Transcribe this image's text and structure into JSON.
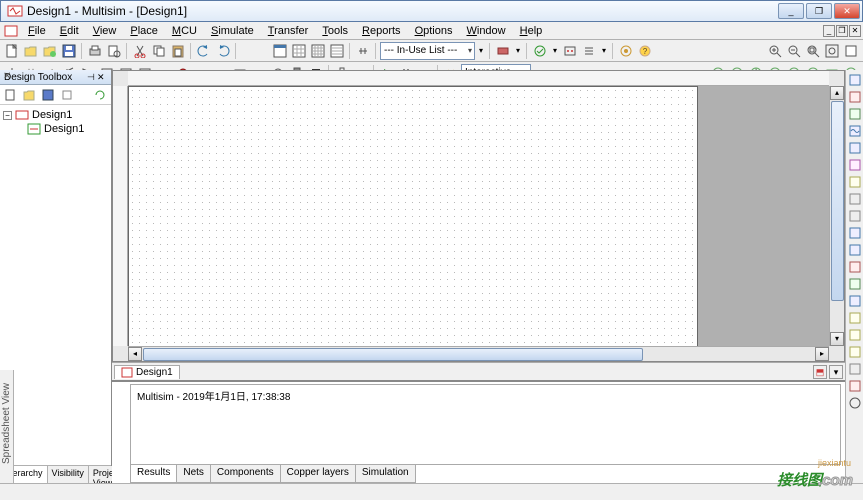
{
  "window": {
    "title": "Design1 - Multisim - [Design1]",
    "controls": {
      "min": "_",
      "max": "❐",
      "close": "✕"
    },
    "mdi": {
      "min": "_",
      "max": "❐",
      "close": "✕"
    }
  },
  "menus": [
    "File",
    "Edit",
    "View",
    "Place",
    "MCU",
    "Simulate",
    "Transfer",
    "Tools",
    "Reports",
    "Options",
    "Window",
    "Help"
  ],
  "toolbar1": {
    "in_use_list": "--- In-Use List ---"
  },
  "toolbar2": {
    "interactive": "Interactive"
  },
  "design_toolbox": {
    "title": "Design Toolbox",
    "tree": {
      "root": "Design1",
      "child": "Design1"
    },
    "tabs": [
      "Hierarchy",
      "Visibility",
      "Project View"
    ]
  },
  "doc_tabs": {
    "active": "Design1"
  },
  "log": {
    "line": "Multisim  -  2019年1月1日, 17:38:38",
    "tabs": [
      "Results",
      "Nets",
      "Components",
      "Copper layers",
      "Simulation"
    ]
  },
  "side_label": "Spreadsheet View",
  "watermark": {
    "a": "接线图",
    "b": ".com",
    "sub": "jiexiantu"
  }
}
